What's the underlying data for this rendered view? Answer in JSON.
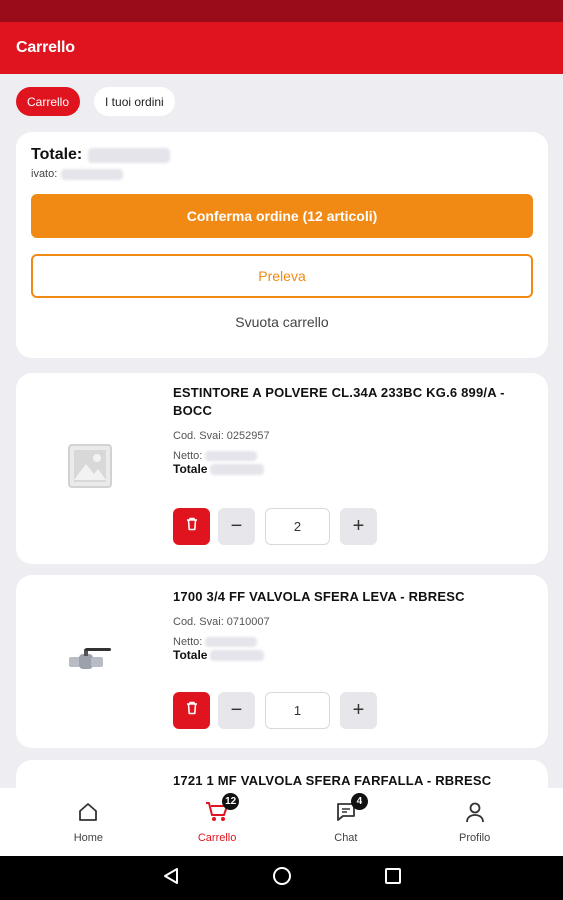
{
  "app": {
    "title": "Carrello",
    "accent": "#e0141e",
    "orange": "#f08a14"
  },
  "tabs": [
    {
      "label": "Carrello",
      "active": true
    },
    {
      "label": "I tuoi ordini",
      "active": false
    }
  ],
  "summary": {
    "total_label": "Totale:",
    "ivato_label": "ivato:",
    "confirm_label": "Conferma ordine (12 articoli)",
    "preleva_label": "Preleva",
    "svuota_label": "Svuota carrello"
  },
  "items": [
    {
      "title": "ESTINTORE A POLVERE CL.34A 233BC KG.6 899/A - BOCC",
      "code": "Cod. Svai: 0252957",
      "netto_label": "Netto:",
      "totale_label": "Totale",
      "quantity": "2",
      "image": "placeholder-image-icon"
    },
    {
      "title": "1700 3/4 FF VALVOLA SFERA LEVA - RBRESC",
      "code": "Cod. Svai: 0710007",
      "netto_label": "Netto:",
      "totale_label": "Totale",
      "quantity": "1",
      "image": "ball-valve-image"
    },
    {
      "title": "1721 1 MF VALVOLA SFERA FARFALLA - RBRESC"
    }
  ],
  "bottom_nav": [
    {
      "label": "Home",
      "icon": "home-icon",
      "active": false
    },
    {
      "label": "Carrello",
      "icon": "cart-icon",
      "active": true,
      "badge": "12"
    },
    {
      "label": "Chat",
      "icon": "chat-icon",
      "active": false,
      "badge": "4"
    },
    {
      "label": "Profilo",
      "icon": "profile-icon",
      "active": false
    }
  ],
  "system_nav": [
    "back-icon",
    "home-circle-icon",
    "recents-icon"
  ]
}
